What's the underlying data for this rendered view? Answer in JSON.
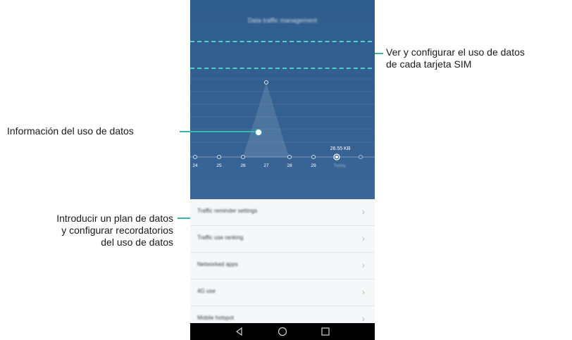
{
  "screen": {
    "title": "Data traffic management",
    "selected_usage": "26.55 KB",
    "today_label": "Today",
    "days": [
      "24",
      "25",
      "26",
      "27",
      "28",
      "29"
    ]
  },
  "list": {
    "items": [
      {
        "label": "Traffic reminder settings"
      },
      {
        "label": "Traffic use ranking"
      },
      {
        "label": "Networked apps"
      },
      {
        "label": "4G use"
      },
      {
        "label": "Mobile hotspot"
      }
    ],
    "chevron": "›"
  },
  "callouts": {
    "sim": [
      "Ver y configurar el uso de datos",
      "de cada tarjeta SIM"
    ],
    "usage": "Información del uso de datos",
    "plan": [
      "Introducir un plan de datos",
      "y configurar recordatorios",
      "del uso de datos"
    ]
  },
  "colors": {
    "hero_bg": "#335f91",
    "accent": "#37b7ab",
    "sim_box": "#4fd0c6"
  },
  "icons": {
    "back": "back-triangle-icon",
    "home": "home-circle-icon",
    "recents": "recents-square-icon"
  }
}
